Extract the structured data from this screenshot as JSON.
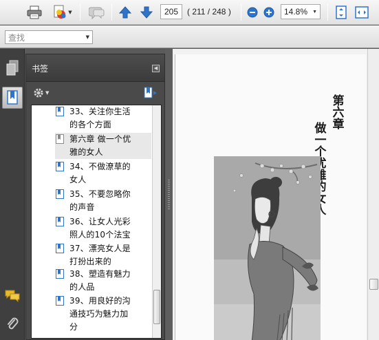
{
  "toolbar": {
    "page_number": "205",
    "page_count": "( 211 / 248 )",
    "zoom": "14.8%",
    "icons": [
      "print-icon",
      "share-icon",
      "comment-icon",
      "prev-page-icon",
      "next-page-icon",
      "zoom-out-icon",
      "zoom-in-icon",
      "fit-page-icon",
      "fit-width-icon"
    ]
  },
  "find": {
    "placeholder": "查找"
  },
  "panel": {
    "title": "书签",
    "bookmarks": [
      {
        "label": "33、关注你生活的各个方面",
        "lines": [
          "33、关注你生活",
          "的各个方面"
        ],
        "selected": false
      },
      {
        "label": "第六章 做一个优雅的女人",
        "lines": [
          "第六章 做一个优",
          "雅的女人"
        ],
        "selected": true
      },
      {
        "label": "34、不做潦草的女人",
        "lines": [
          "34、不做潦草的",
          "女人"
        ],
        "selected": false
      },
      {
        "label": "35、不要忽略你的声音",
        "lines": [
          "35、不要忽略你",
          "的声音"
        ],
        "selected": false
      },
      {
        "label": "36、让女人光彩照人的10个法宝",
        "lines": [
          "36、让女人光彩",
          "照人的10个法宝"
        ],
        "selected": false
      },
      {
        "label": "37、漂亮女人是打扮出来的",
        "lines": [
          "37、漂亮女人是",
          "打扮出来的"
        ],
        "selected": false
      },
      {
        "label": "38、塑造有魅力的人品",
        "lines": [
          "38、塑造有魅力",
          "的人品"
        ],
        "selected": false
      },
      {
        "label": "39、用良好的沟通技巧为魅力加分",
        "lines": [
          "39、用良好的沟",
          "通技巧为魅力加",
          "分"
        ],
        "selected": false
      }
    ]
  },
  "document": {
    "chapter_heading": "第六章",
    "chapter_title": "做一个优雅的女人"
  },
  "colors": {
    "toolbar_bg": "#e6e6e6",
    "panel_bg": "#4a4a4a",
    "accent_blue": "#2f74c9",
    "illustration_bg": "#a9a9a9"
  }
}
